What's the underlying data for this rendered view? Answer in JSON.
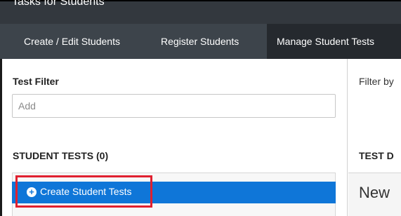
{
  "window": {
    "title": "Tasks for Students"
  },
  "nav": {
    "tabs": [
      {
        "label": "Create / Edit Students"
      },
      {
        "label": "Register Students"
      },
      {
        "label": "Manage Student Tests",
        "active": true
      }
    ]
  },
  "filter": {
    "label": "Test Filter",
    "placeholder": "Add",
    "value": "",
    "right_label": "Filter by"
  },
  "student_tests": {
    "heading": "STUDENT TESTS (0)",
    "create_label": "Create Student Tests",
    "create_icon": "plus-circle-icon"
  },
  "test_details": {
    "heading": "TEST D",
    "new_label": "New"
  },
  "colors": {
    "header_bg": "#33383e",
    "nav_bg": "#3d444b",
    "active_tab_bg": "#25292e",
    "accent_blue": "#0f76d8",
    "highlight_red": "#e0202f"
  }
}
